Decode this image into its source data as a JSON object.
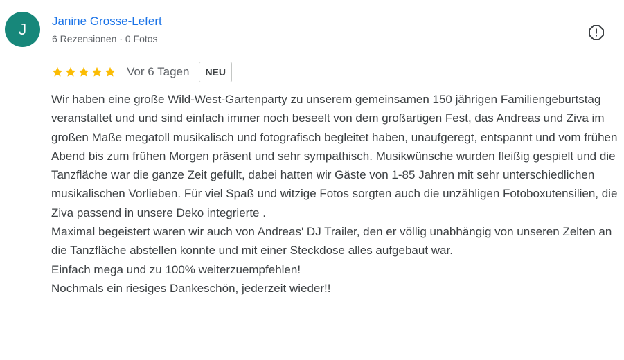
{
  "reviewer": {
    "initial": "J",
    "name": "Janine Grosse-Lefert",
    "meta": "6 Rezensionen · 0 Fotos",
    "avatar_color": "#17877a"
  },
  "report_icon": "report-flag-icon",
  "rating": {
    "stars": 5,
    "star_color": "#fbbc04",
    "date": "Vor 6 Tagen",
    "badge": "NEU"
  },
  "review": {
    "paragraphs": [
      "Wir haben eine große Wild-West-Gartenparty zu unserem gemeinsamen 150 jährigen Familiengeburtstag veranstaltet und und sind einfach immer noch beseelt von dem großartigen Fest, das Andreas und Ziva im großen Maße megatoll musikalisch und fotografisch begleitet haben, unaufgeregt, entspannt und vom frühen Abend bis zum frühen Morgen präsent und sehr sympathisch. Musikwünsche wurden fleißig gespielt und die Tanzfläche war die ganze Zeit gefüllt, dabei hatten wir Gäste von 1-85 Jahren mit sehr unterschiedlichen musikalischen Vorlieben. Für viel Spaß und witzige Fotos sorgten auch die unzähligen Fotoboxutensilien, die Ziva passend in unsere Deko integrierte .",
      "Maximal begeistert waren wir auch von Andreas' DJ Trailer, den er völlig unabhängig von unseren Zelten an die Tanzfläche abstellen konnte und mit einer Steckdose alles aufgebaut war.",
      "Einfach mega und zu 100% weiterzuempfehlen!",
      "Nochmals ein riesiges Dankeschön, jederzeit wieder!!"
    ]
  }
}
